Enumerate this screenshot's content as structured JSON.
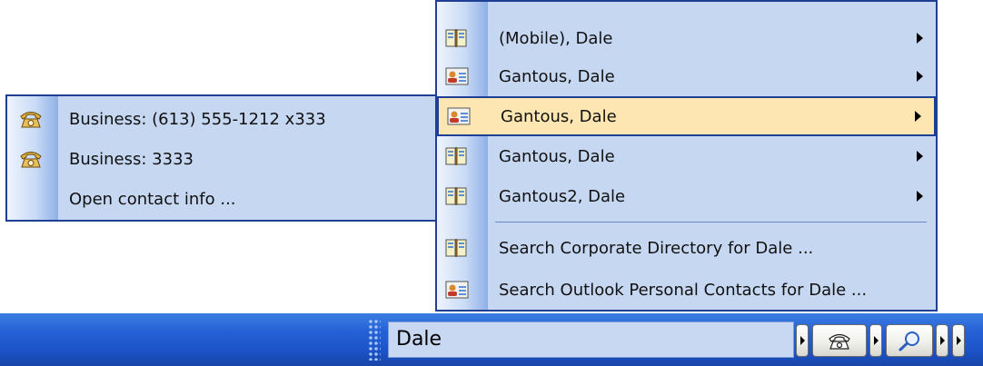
{
  "main_menu": {
    "items": [
      {
        "label": "(Mobile), Dale",
        "icon": "address-book-icon",
        "has_submenu": true
      },
      {
        "label": "Gantous, Dale",
        "icon": "contact-card-icon",
        "has_submenu": true
      },
      {
        "label": "Gantous, Dale",
        "icon": "contact-card-icon",
        "has_submenu": true,
        "selected": true
      },
      {
        "label": "Gantous, Dale",
        "icon": "address-book-icon",
        "has_submenu": true
      },
      {
        "label": "Gantous2, Dale",
        "icon": "address-book-icon",
        "has_submenu": true
      },
      {
        "label": "Search Corporate Directory for Dale ...",
        "icon": "address-book-icon",
        "has_submenu": false
      },
      {
        "label": "Search Outlook Personal Contacts for Dale ...",
        "icon": "contact-card-icon",
        "has_submenu": false
      }
    ]
  },
  "submenu": {
    "items": [
      {
        "label": "Business: (613) 555-1212 x333",
        "icon": "telephone-icon"
      },
      {
        "label": "Business: 3333",
        "icon": "telephone-icon"
      },
      {
        "label": "Open contact info ...",
        "icon": ""
      }
    ]
  },
  "taskbar": {
    "search_value": "Dale",
    "buttons": [
      "expand-button",
      "dial-button",
      "search-button",
      "more-button"
    ]
  },
  "colors": {
    "menu_background": "#c6d7f2",
    "menu_border": "#1f3f95",
    "selected_item": "#fde6b1",
    "taskbar": "#2561d6"
  }
}
